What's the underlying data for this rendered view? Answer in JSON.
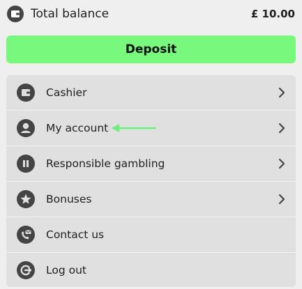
{
  "balance": {
    "label": "Total balance",
    "amount": "£ 10.00",
    "icon": "wallet-icon"
  },
  "deposit": {
    "label": "Deposit"
  },
  "menu": {
    "items": [
      {
        "label": "Cashier",
        "icon": "wallet-icon",
        "has_chevron": true
      },
      {
        "label": "My account",
        "icon": "user-icon",
        "has_chevron": true
      },
      {
        "label": "Responsible gambling",
        "icon": "pause-icon",
        "has_chevron": true
      },
      {
        "label": "Bonuses",
        "icon": "star-icon",
        "has_chevron": true
      },
      {
        "label": "Contact us",
        "icon": "phone-mail-icon",
        "has_chevron": false
      },
      {
        "label": "Log out",
        "icon": "logout-icon",
        "has_chevron": false
      }
    ]
  },
  "colors": {
    "background": "#efefef",
    "deposit_green": "#78f87d",
    "menu_background": "#e0e0e0",
    "icon_dark": "#444444",
    "annotation_arrow": "#6cf07a"
  }
}
